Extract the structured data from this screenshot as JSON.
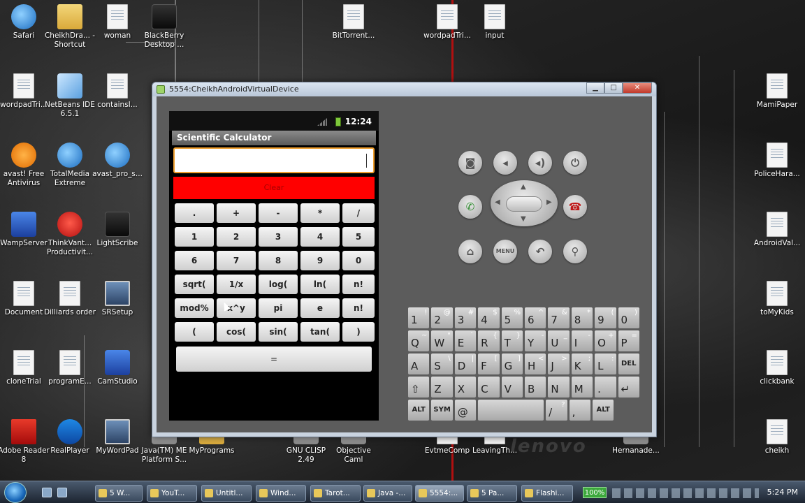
{
  "desktop": {
    "icons": [
      {
        "label": "Safari"
      },
      {
        "label": "CheikhDra... - Shortcut"
      },
      {
        "label": "woman"
      },
      {
        "label": "BlackBerry Desktop ..."
      },
      {
        "label": "BitTorrent..."
      },
      {
        "label": "wordpadTri..."
      },
      {
        "label": "input"
      },
      {
        "label": "wordpadTri..."
      },
      {
        "label": "NetBeans IDE 6.5.1"
      },
      {
        "label": "containsI..."
      },
      {
        "label": "MamiPaper"
      },
      {
        "label": "avast! Free Antivirus"
      },
      {
        "label": "TotalMedia Extreme"
      },
      {
        "label": "avast_pro_s..."
      },
      {
        "label": "PoliceHara..."
      },
      {
        "label": "WampServer"
      },
      {
        "label": "ThinkVant... Productivit..."
      },
      {
        "label": "LightScribe"
      },
      {
        "label": "AndroidVal..."
      },
      {
        "label": "Document"
      },
      {
        "label": "Dilliards order"
      },
      {
        "label": "SRSetup"
      },
      {
        "label": "toMyKids"
      },
      {
        "label": "cloneTrial"
      },
      {
        "label": "programE..."
      },
      {
        "label": "CamStudio"
      },
      {
        "label": "clickbank"
      },
      {
        "label": "Adobe Reader 8"
      },
      {
        "label": "RealPlayer"
      },
      {
        "label": "MyWordPad"
      },
      {
        "label": "Java(TM) ME Platform S..."
      },
      {
        "label": "MyPrograms"
      },
      {
        "label": "GNU CLISP 2.49"
      },
      {
        "label": "Objective Caml"
      },
      {
        "label": "EvtmeComp"
      },
      {
        "label": "LeavingTh..."
      },
      {
        "label": "Hernanade..."
      },
      {
        "label": "cheikh"
      }
    ],
    "wallpaper_brand": "lenovo"
  },
  "window": {
    "title": "5554:CheikhAndroidVirtualDevice",
    "minimize": "▁",
    "maximize": "□",
    "close": "✕"
  },
  "phone": {
    "status_time": "12:24",
    "app_title": "Scientific Calculator",
    "input_value": "",
    "clear_label": "Clear",
    "keys": [
      [
        ".",
        "+",
        "-",
        "*",
        "/"
      ],
      [
        "1",
        "2",
        "3",
        "4",
        "5"
      ],
      [
        "6",
        "7",
        "8",
        "9",
        "0"
      ],
      [
        "sqrt(",
        "1/x",
        "log(",
        "ln(",
        "n!"
      ],
      [
        "mod%",
        "x^y",
        "pi",
        "e",
        "n!"
      ],
      [
        "(",
        "cos(",
        "sin(",
        "tan(",
        ")"
      ]
    ],
    "equals_label": "="
  },
  "hardware": {
    "camera": "camera-icon",
    "vol_down": "volume-down-icon",
    "vol_up": "volume-up-icon",
    "power": "power-icon",
    "call": "call-icon",
    "end_call": "end-call-icon",
    "home": "home-icon",
    "menu_label": "MENU",
    "back": "back-icon",
    "search": "search-icon"
  },
  "keyboard": {
    "row1": [
      [
        "1",
        "!"
      ],
      [
        "2",
        "@"
      ],
      [
        "3",
        "#"
      ],
      [
        "4",
        "$"
      ],
      [
        "5",
        "%"
      ],
      [
        "6",
        "^"
      ],
      [
        "7",
        "&"
      ],
      [
        "8",
        "*"
      ],
      [
        "9",
        "("
      ],
      [
        "0",
        ")"
      ]
    ],
    "row2": [
      [
        "Q",
        "~"
      ],
      [
        "W",
        "\""
      ],
      [
        "E",
        "`"
      ],
      [
        "R",
        "{"
      ],
      [
        "T",
        "}"
      ],
      [
        "Y",
        "-"
      ],
      [
        "U",
        "_"
      ],
      [
        "I",
        "-"
      ],
      [
        "O",
        "+"
      ],
      [
        "P",
        "="
      ]
    ],
    "row3": [
      [
        "A",
        ""
      ],
      [
        "S",
        "\\"
      ],
      [
        "D",
        "|"
      ],
      [
        "F",
        "["
      ],
      [
        "G",
        "]"
      ],
      [
        "H",
        "<"
      ],
      [
        "J",
        ">"
      ],
      [
        "K",
        ";"
      ],
      [
        "L",
        ":"
      ],
      [
        "DEL",
        ""
      ]
    ],
    "row4": [
      [
        "⇧",
        ""
      ],
      [
        "Z",
        ""
      ],
      [
        "X",
        ""
      ],
      [
        "C",
        ""
      ],
      [
        "V",
        ""
      ],
      [
        "B",
        ""
      ],
      [
        "N",
        ""
      ],
      [
        "M",
        ""
      ],
      [
        ".",
        ""
      ],
      [
        "↵",
        ""
      ]
    ],
    "row5": [
      [
        "ALT",
        ""
      ],
      [
        "SYM",
        ""
      ],
      [
        "@",
        ""
      ],
      [
        "",
        ""
      ],
      [
        "/",
        "?"
      ],
      [
        ",",
        ""
      ],
      [
        "ALT",
        ""
      ]
    ]
  },
  "taskbar": {
    "items": [
      {
        "label": "5 W..."
      },
      {
        "label": "YouT..."
      },
      {
        "label": "Untitl..."
      },
      {
        "label": "Wind..."
      },
      {
        "label": "Tarot..."
      },
      {
        "label": "Java -..."
      },
      {
        "label": "5554:..."
      },
      {
        "label": "5 Pa..."
      },
      {
        "label": "Flashi..."
      }
    ],
    "battery": "100%",
    "clock": "5:24 PM"
  }
}
